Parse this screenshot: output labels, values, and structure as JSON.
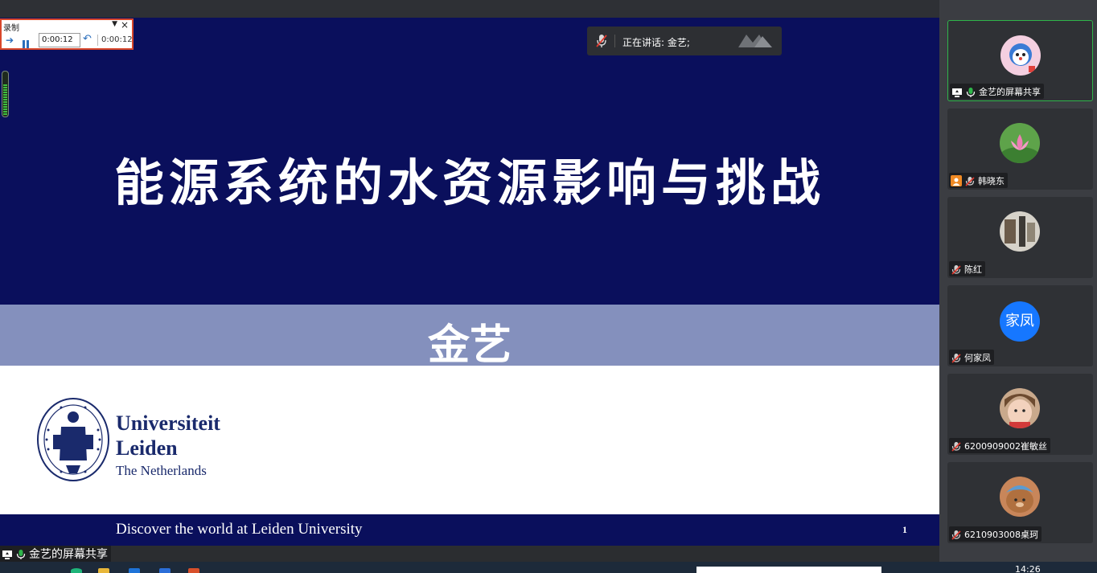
{
  "recorder": {
    "title": "录制",
    "menu_icon": "triangle-down-icon",
    "close_icon": "close-icon",
    "time_value": "0:00:12",
    "elapsed": "0:00:12"
  },
  "speaker": {
    "text": "正在讲话: 金艺;"
  },
  "slide": {
    "title": "能源系统的水资源影响与挑战",
    "author": "金艺",
    "university_line1": "Universiteit",
    "university_line2": "Leiden",
    "university_line3": "The Netherlands",
    "footer": "Discover the world at Leiden University",
    "page_number": "1"
  },
  "participants": [
    {
      "name": "金艺的屏幕共享",
      "avatar": "cartoon-avatar",
      "active": true,
      "icons": [
        "screen-share-icon",
        "mic-on-icon"
      ]
    },
    {
      "name": "韩晓东",
      "avatar": "lotus-avatar",
      "active": false,
      "icons": [
        "host-icon",
        "mic-muted-icon"
      ]
    },
    {
      "name": "陈红",
      "avatar": "photo-avatar",
      "active": false,
      "icons": [
        "mic-muted-icon"
      ]
    },
    {
      "name": "何家凤",
      "avatar_text": "家凤",
      "active": false,
      "icons": [
        "mic-muted-icon"
      ]
    },
    {
      "name": "6200909002崔敏丝",
      "avatar": "child-avatar",
      "active": false,
      "icons": [
        "mic-muted-icon"
      ]
    },
    {
      "name": "6210903008桌珂",
      "avatar": "bear-avatar",
      "active": false,
      "icons": [
        "mic-muted-icon"
      ]
    }
  ],
  "share_label": "金艺的屏幕共享",
  "taskbar": {
    "time": "14:26"
  },
  "colors": {
    "slide_navy": "#0a0f5c",
    "slide_band": "#8490bd",
    "active_green": "#2fb54a",
    "avatar_blue": "#1677ff",
    "recorder_border": "#d9472b"
  }
}
